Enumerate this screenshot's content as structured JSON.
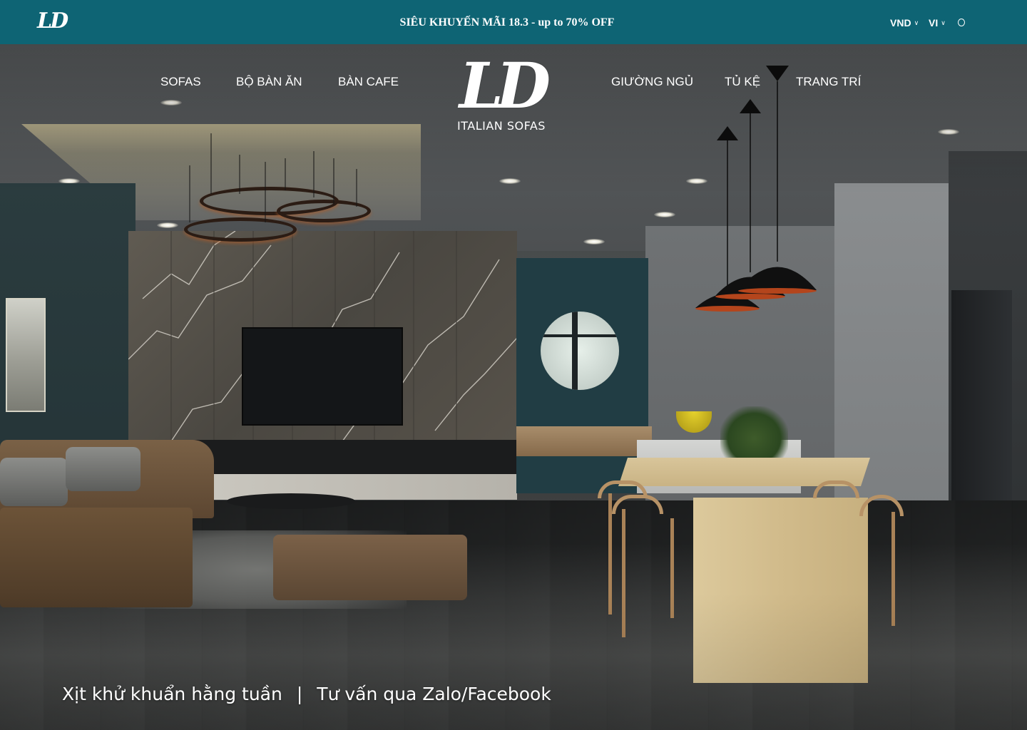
{
  "topbar": {
    "logo": "LD",
    "promo": "SIÊU KHUYẾN MÃI 18.3 - up to 70% OFF",
    "currency": "VND",
    "language": "VI",
    "background_color": "#0e6474",
    "search_icon": "search-icon"
  },
  "nav": {
    "left": [
      "SOFAS",
      "BỘ BÀN ĂN",
      "BÀN CAFE"
    ],
    "right": [
      "GIƯỜNG NGỦ",
      "TỦ KỆ",
      "TRANG TRÍ"
    ]
  },
  "logo": {
    "mark": "LD",
    "tagline": "ITALIAN SOFAS"
  },
  "features": {
    "item1": "Xịt khử khuẩn hằng tuần",
    "separator": "|",
    "item2": "Tư vấn qua Zalo/Facebook"
  }
}
